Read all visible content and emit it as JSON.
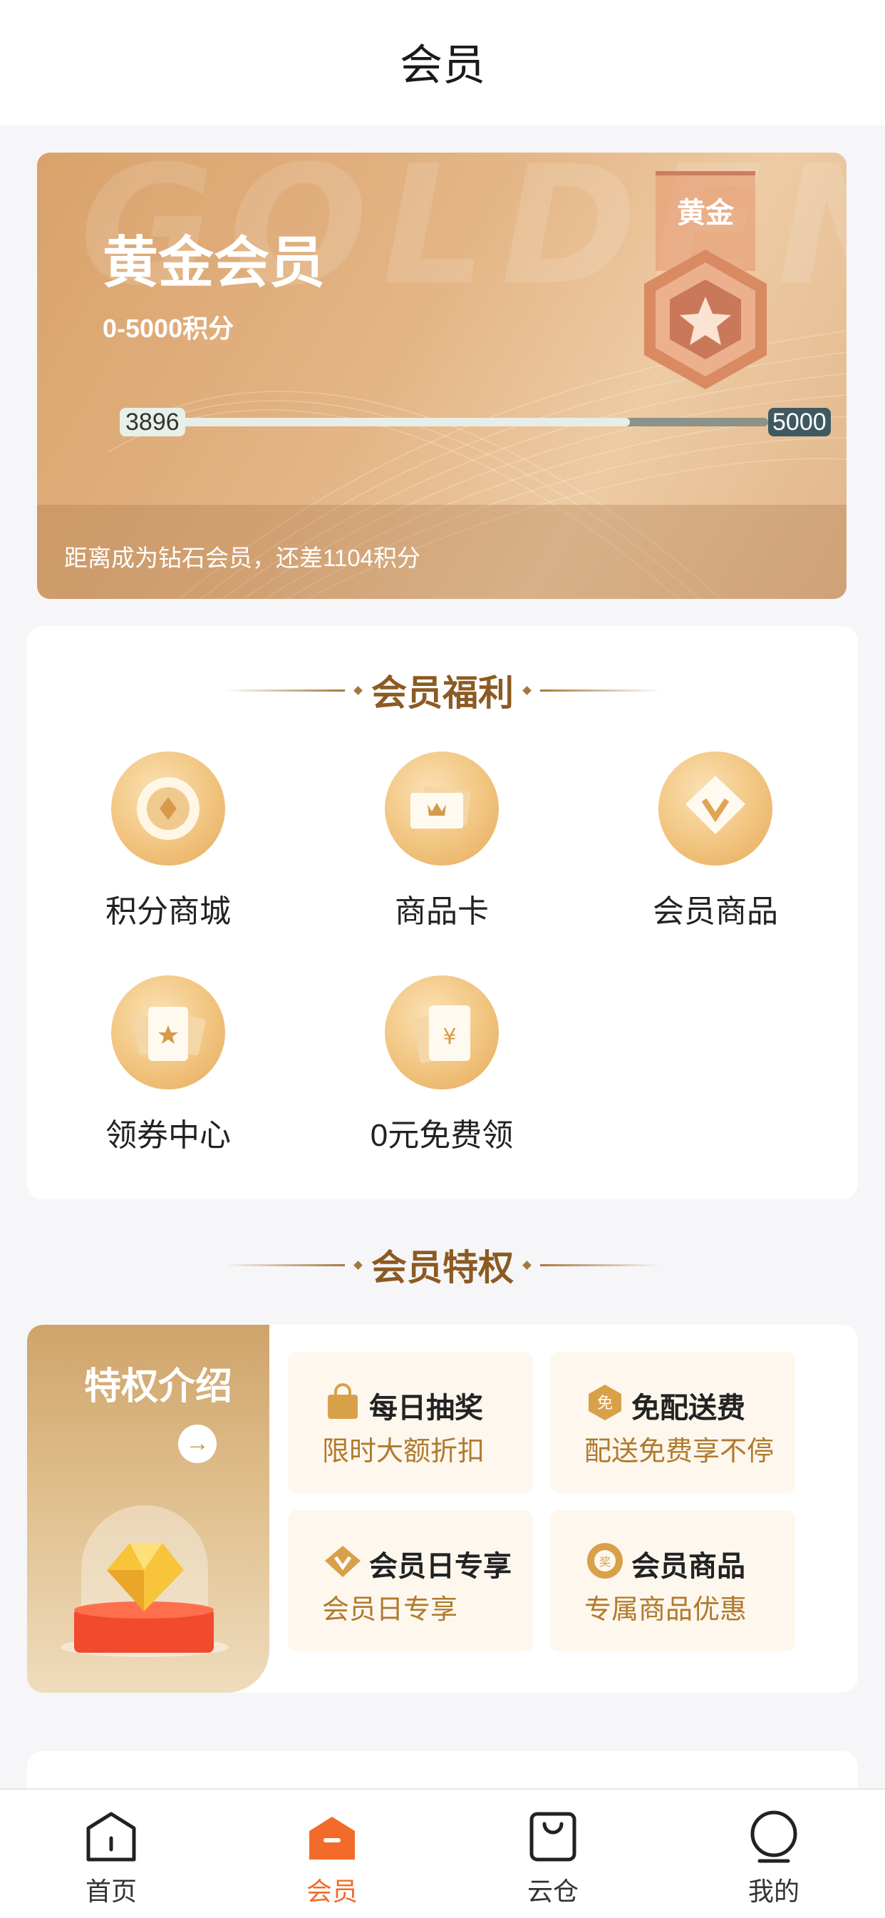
{
  "header": {
    "title": "会员"
  },
  "card": {
    "watermark": "GOLDEN",
    "level_name": "黄金会员",
    "range": "0-5000积分",
    "badge_label": "黄金",
    "progress": {
      "current": "3896",
      "max": "5000",
      "fraction": 0.78
    },
    "footer_text": "距离成为钻石会员，还差1104积分"
  },
  "benefits": {
    "title": "会员福利",
    "items": [
      {
        "label": "积分商城",
        "icon": "coin-icon"
      },
      {
        "label": "商品卡",
        "icon": "card-icon"
      },
      {
        "label": "会员商品",
        "icon": "diamond-v-icon"
      },
      {
        "label": "领券中心",
        "icon": "ticket-icon"
      },
      {
        "label": "0元免费领",
        "icon": "red-envelope-icon"
      }
    ]
  },
  "privileges": {
    "title": "会员特权",
    "intro_title": "特权介绍",
    "items": [
      {
        "name": "每日抽奖",
        "desc": "限时大额折扣",
        "icon": "bag-icon"
      },
      {
        "name": "免配送费",
        "desc": "配送免费享不停",
        "icon": "free-shipping-icon"
      },
      {
        "name": "会员日专享",
        "desc": "会员日专享",
        "icon": "v-icon"
      },
      {
        "name": "会员商品",
        "desc": "专属商品优惠",
        "icon": "prize-icon"
      }
    ]
  },
  "tabbar": {
    "items": [
      {
        "label": "首页",
        "icon": "home-icon"
      },
      {
        "label": "会员",
        "icon": "member-icon",
        "active": true
      },
      {
        "label": "云仓",
        "icon": "cloud-warehouse-icon"
      },
      {
        "label": "我的",
        "icon": "profile-icon"
      }
    ]
  },
  "colors": {
    "accent": "#f26b2a",
    "gold_text": "#8c5a22",
    "brown_desc": "#b07a2c"
  }
}
